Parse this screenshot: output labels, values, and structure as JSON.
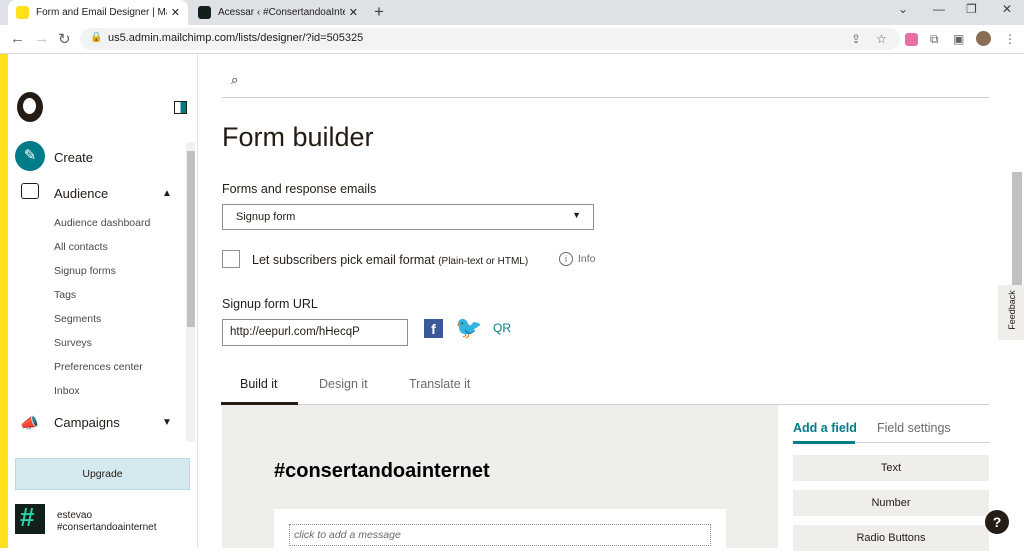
{
  "browser": {
    "tabs": [
      {
        "title": "Form and Email Designer | Mailchi",
        "close": "✕"
      },
      {
        "title": "Acessar ‹ #ConsertandoaInternet",
        "close": "✕"
      }
    ],
    "new_tab": "+",
    "url": "us5.admin.mailchimp.com/lists/designer/?id=505325",
    "colors": {
      "tab_favicon_active": "#ffe01b",
      "tab_favicon_inactive": "#11201b"
    }
  },
  "sidebar": {
    "create_label": "Create",
    "audience_label": "Audience",
    "audience_items": [
      "Audience dashboard",
      "All contacts",
      "Signup forms",
      "Tags",
      "Segments",
      "Surveys",
      "Preferences center",
      "Inbox"
    ],
    "campaigns_label": "Campaigns",
    "upgrade_label": "Upgrade",
    "user_name": "estevao",
    "user_org": "#consertandoainternet"
  },
  "main": {
    "page_title": "Form builder",
    "forms_label": "Forms and response emails",
    "form_select_value": "Signup form",
    "checkbox_label": "Let subscribers pick email format",
    "checkbox_hint": "(Plain-text or HTML)",
    "info_label": "Info",
    "url_label": "Signup form URL",
    "signup_url": "http://eepurl.com/hHecqP",
    "facebook_glyph": "f",
    "qr_label": "QR",
    "tabs": [
      "Build it",
      "Design it",
      "Translate it"
    ],
    "form_name": "#consertandoainternet",
    "message_placeholder": "click to add a message"
  },
  "panel": {
    "tabs": [
      "Add a field",
      "Field settings"
    ],
    "field_buttons": [
      "Text",
      "Number",
      "Radio Buttons"
    ]
  },
  "feedback_label": "Feedback",
  "help_label": "?",
  "colors": {
    "brand_yellow": "#ffe01b",
    "accent_teal": "#007c89",
    "canvas_bg": "#efeeea"
  }
}
